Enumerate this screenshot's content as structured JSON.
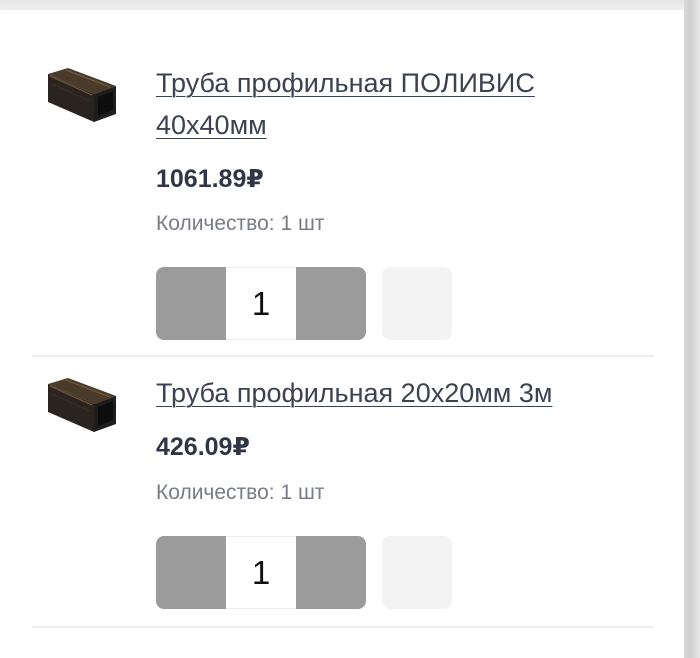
{
  "cart": {
    "items": [
      {
        "title": "Труба профильная ПОЛИВИС 40х40мм",
        "price": "1061.89₽",
        "quantity_label": "Количество: 1 шт",
        "quantity_value": "1",
        "image_icon": "steel-profile-pipe-icon"
      },
      {
        "title": "Труба профильная 20х20мм 3м",
        "price": "426.09₽",
        "quantity_label": "Количество: 1 шт",
        "quantity_value": "1",
        "image_icon": "steel-profile-pipe-icon"
      }
    ]
  },
  "colors": {
    "title": "#3b4251",
    "price": "#2f3645",
    "stepper_button": "#9b9b9b",
    "extra_button": "#f3f3f3"
  }
}
